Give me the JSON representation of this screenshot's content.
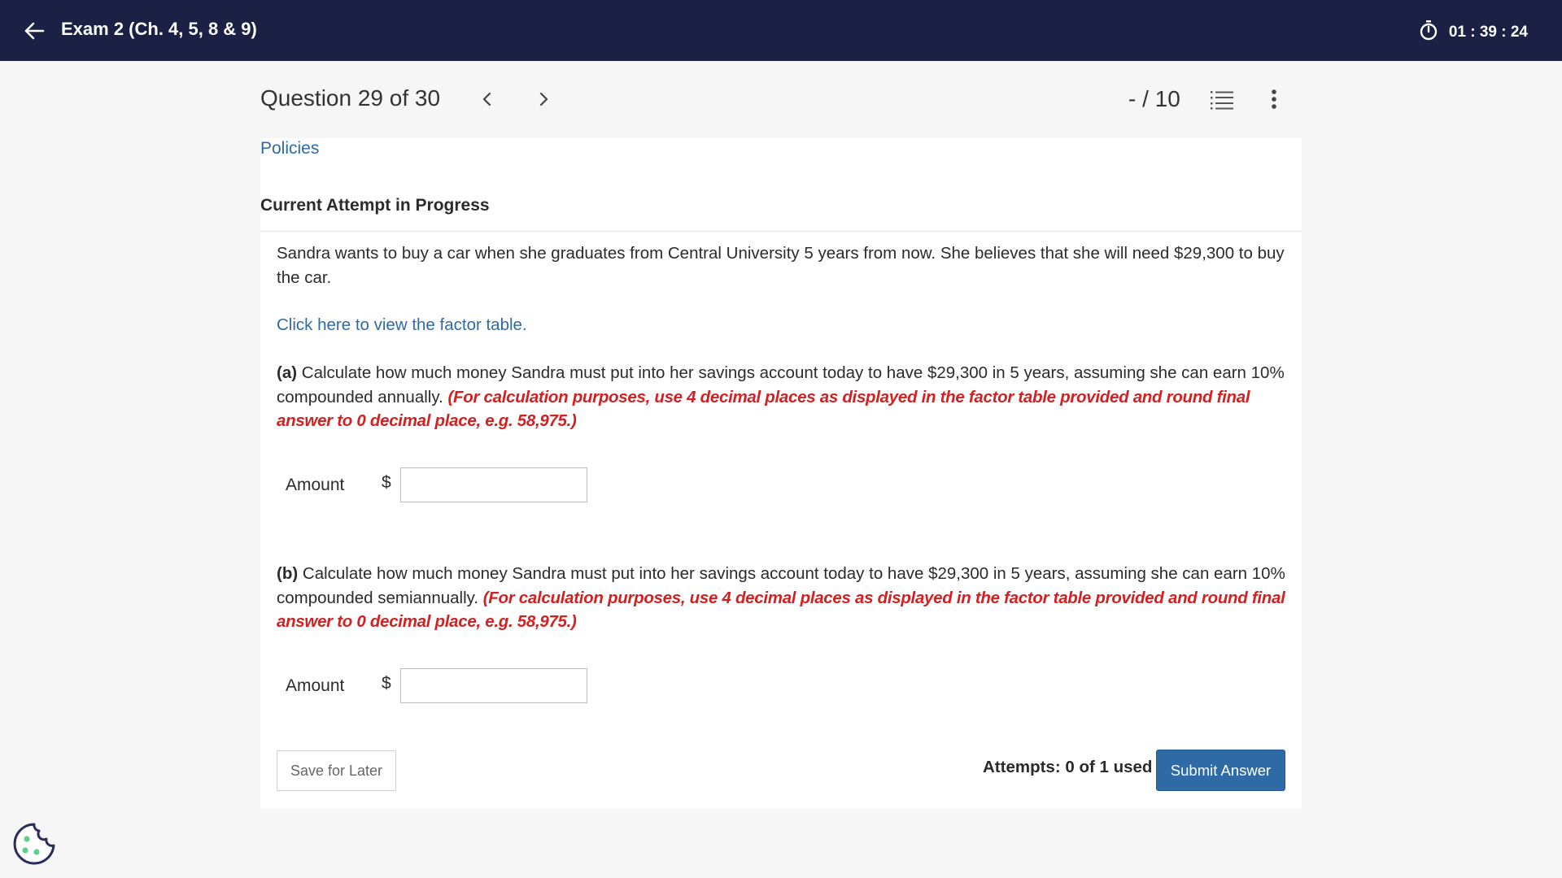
{
  "header": {
    "exam_title": "Exam 2 (Ch. 4, 5, 8 & 9)",
    "timer": "01 : 39 : 24",
    "back_icon": "arrow-left-icon",
    "timer_icon": "stopwatch-icon"
  },
  "question_nav": {
    "title": "Question 29 of 30",
    "score": "- / 10",
    "prev_icon": "chevron-left-icon",
    "next_icon": "chevron-right-icon",
    "list_icon": "numbered-list-icon",
    "more_icon": "more-vertical-icon"
  },
  "main": {
    "policies_link": "Policies",
    "attempt_heading": "Current Attempt in Progress",
    "intro": "Sandra wants to buy a car when she graduates from Central University 5 years from now. She believes that she will need $29,300 to buy the car.",
    "factor_link": "Click here to view the factor table.",
    "part_a": {
      "label": "(a)",
      "text": " Calculate how much money Sandra must put into her savings account today to have $29,300 in 5 years, assuming she can earn 10% compounded annually. ",
      "instruction": "(For calculation purposes, use 4 decimal places as displayed in the factor table provided and round final answer to 0 decimal place, e.g. 58,975.)",
      "amount_label": "Amount",
      "currency": "$",
      "value": ""
    },
    "part_b": {
      "label": "(b)",
      "text": " Calculate how much money Sandra must put into her savings account today to have $29,300 in 5 years, assuming she can earn 10% compounded semiannually. ",
      "instruction": "(For calculation purposes, use 4 decimal places as displayed in the factor table provided and round final answer to 0 decimal place, e.g. 58,975.)",
      "amount_label": "Amount",
      "currency": "$",
      "value": ""
    }
  },
  "footer": {
    "save_label": "Save for Later",
    "attempts": "Attempts: 0 of 1 used",
    "submit_label": "Submit Answer"
  },
  "cookie_icon": "cookie-icon",
  "colors": {
    "header_bg": "#1b2145",
    "link": "#2e6aa5",
    "instruction_red": "#d42020",
    "submit_bg": "#2e6aa5"
  }
}
